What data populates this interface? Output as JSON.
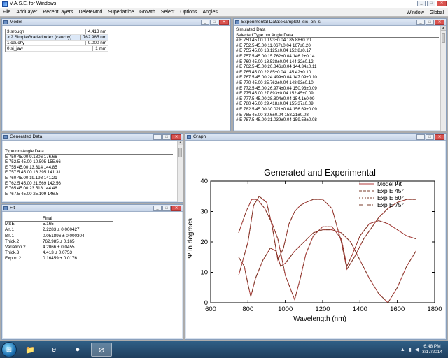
{
  "app": {
    "title": "V.A.S.E. for Windows",
    "menu": [
      "File",
      "AddLayer",
      "RecentLayers",
      "DeleteMod",
      "Superlattice",
      "Growth",
      "Select",
      "Options",
      "Angles"
    ],
    "menu_right": [
      "Window",
      "Global"
    ]
  },
  "model": {
    "title": "Model",
    "rows": [
      {
        "label": "3 srough",
        "value": "4.413 nm"
      },
      {
        "label": "> 2 SimpleGradedIndex (cauchy)",
        "value": "762.985 nm"
      },
      {
        "label": "1 cauchy",
        "value": "0.000 nm"
      },
      {
        "label": "0 si_jaw",
        "value": "1 mm"
      }
    ]
  },
  "exp": {
    "title": "Experimental Data:example9_sic_on_si",
    "header1": "Simulated Data",
    "header2": "Selected Type  nm  Angle  Data",
    "rows": [
      "# E  750  45.00  10.93±0.04  185.88±0.20",
      "# E  752.5  45.00  11.067±0.04  167±0.20",
      "# E  755  45.00  13.125±0.04  152.8±0.17",
      "# E  757.5  45.00  15.762±0.04  146.2±0.14",
      "# E  760  45.00  18.538±0.04  144.32±0.12",
      "# E  762.5  45.00  20.846±0.04  144.34±0.11",
      "# E  765  45.00  22.85±0.04  145.42±0.10",
      "# E  767.5  45.00  24.499±0.04  147.09±0.10",
      "# E  770  45.00  25.762±0.04  148.93±0.10",
      "# E  772.5  45.00  26.974±0.04  150.93±0.09",
      "# E  775  45.00  27.893±0.04  152.45±0.09",
      "# E  777.5  45.00  28.804±0.04  154.1±0.09",
      "# E  780  45.00  29.418±0.04  155.37±0.09",
      "# E  782.5  45.00  30.021±0.04  156.69±0.09",
      "# E  785  45.00  30.6±0.04  158.21±0.08",
      "# E  787.5  45.00  31.039±0.04  159.58±0.08"
    ]
  },
  "gen": {
    "title": "Generated Data",
    "header": "Type  nm  Angle  Data",
    "rows": [
      "E  750  45.00  9.1806  176.66",
      "E  752.5  45.00  10.505  155.66",
      "E  755  45.00  13.314  144.85",
      "E  757.5  45.00  16.395  141.31",
      "E  760  45.00  19.198  141.21",
      "E  762.5  45.00  21.569  142.56",
      "E  765  45.00  23.518  144.46",
      "E  767.5  45.00  25.109  146.5"
    ]
  },
  "fit": {
    "title": "Fit",
    "col_header": "Final",
    "rows": [
      {
        "k": "MSE",
        "v": "5.165"
      },
      {
        "k": "An.1",
        "v": "2.2283 ± 0.000427"
      },
      {
        "k": "Bn.1",
        "v": "0.051896 ± 0.000304"
      },
      {
        "k": "Thick.2",
        "v": "762.985 ± 0.165"
      },
      {
        "k": "Variation.2",
        "v": "4.2066 ± 0.0455"
      },
      {
        "k": "Thick.3",
        "v": "4.413 ± 0.0753"
      },
      {
        "k": "Expon.2",
        "v": "0.16459 ± 0.0176"
      }
    ]
  },
  "graph": {
    "window_title": "Graph"
  },
  "chart_data": {
    "type": "line",
    "title": "Generated and Experimental",
    "xlabel": "Wavelength (nm)",
    "ylabel": "Ψ in degrees",
    "xlim": [
      600,
      1800
    ],
    "ylim": [
      0,
      40
    ],
    "xticks": [
      600,
      800,
      1000,
      1200,
      1400,
      1600,
      1800
    ],
    "yticks": [
      0,
      10,
      20,
      30,
      40
    ],
    "legend": [
      "Model Fit",
      "Exp E 45°",
      "Exp E 60°",
      "Exp E 75°"
    ],
    "legend_position": "top-right",
    "colors": {
      "model": "#b23a3a",
      "exp": "#7a3b2a"
    },
    "series": [
      {
        "name": "Exp E 45°",
        "x": [
          750,
          800,
          830,
          860,
          900,
          930,
          960,
          990,
          1020,
          1050,
          1080,
          1110,
          1150,
          1200,
          1250,
          1300,
          1330,
          1370,
          1420,
          1500,
          1550,
          1600,
          1650,
          1700
        ],
        "values": [
          9,
          20,
          32,
          35,
          33,
          25,
          14,
          18,
          26,
          30,
          32,
          33,
          34,
          34,
          31,
          20,
          11,
          15,
          21,
          28,
          31,
          33,
          34,
          34
        ]
      },
      {
        "name": "Exp E 60°",
        "x": [
          750,
          790,
          820,
          850,
          890,
          930,
          960,
          1000,
          1050,
          1080,
          1110,
          1150,
          1200,
          1250,
          1300,
          1330,
          1360,
          1400,
          1450,
          1500,
          1550,
          1600,
          1650,
          1700
        ],
        "values": [
          23,
          30,
          34,
          34,
          31,
          26,
          21,
          9,
          1,
          8,
          16,
          22,
          25,
          25,
          21,
          12,
          16,
          22,
          26,
          27,
          26,
          24,
          22,
          21
        ]
      },
      {
        "name": "Exp E 75°",
        "x": [
          750,
          780,
          800,
          815,
          840,
          880,
          920,
          950,
          975,
          1000,
          1050,
          1100,
          1150,
          1200,
          1250,
          1300,
          1350,
          1400,
          1450,
          1500,
          1550,
          1600,
          1650,
          1700
        ],
        "values": [
          15,
          12,
          6,
          2,
          8,
          14,
          18,
          17,
          12,
          13,
          17,
          20,
          23,
          24,
          24,
          23,
          20,
          14,
          8,
          3,
          0,
          5,
          12,
          17
        ]
      }
    ]
  },
  "taskbar": {
    "time": "6:48 PM",
    "date": "3/17/2014"
  }
}
